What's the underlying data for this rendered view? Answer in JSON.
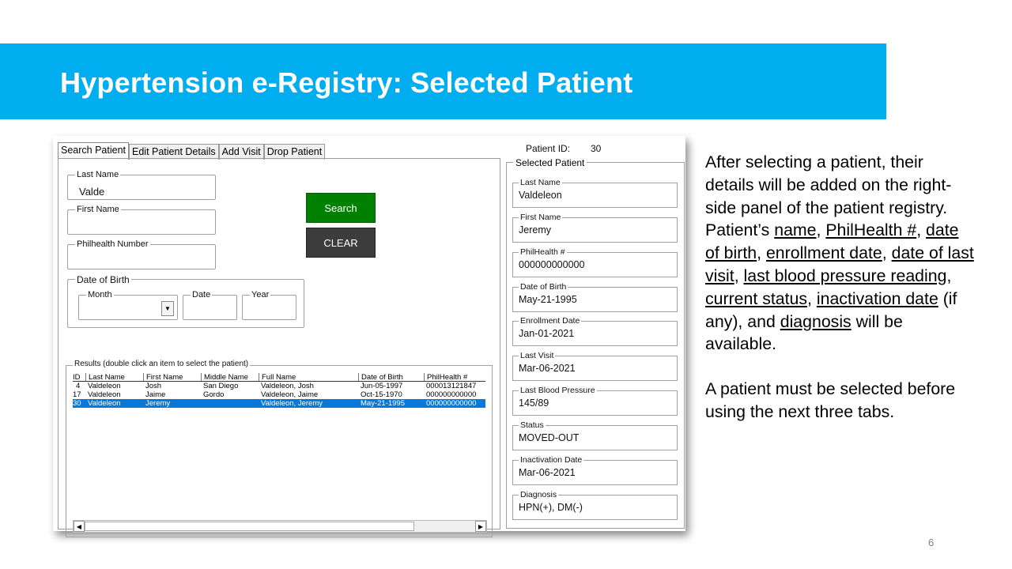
{
  "slide": {
    "title": "Hypertension e-Registry: Selected Patient",
    "number": "6",
    "colors": {
      "banner": "#00adef",
      "search_button": "#008000",
      "clear_button": "#3c3c3c",
      "selected_row": "#0a78d7"
    }
  },
  "app": {
    "tabs": [
      "Search Patient",
      "Edit Patient Details",
      "Add Visit",
      "Drop Patient"
    ],
    "active_tab": "Search Patient",
    "search": {
      "last_name_label": "Last Name",
      "last_name_value": "Valde",
      "first_name_label": "First Name",
      "first_name_value": "",
      "philhealth_label": "Philhealth Number",
      "philhealth_value": "",
      "dob_label": "Date of Birth",
      "month_label": "Month",
      "date_label": "Date",
      "year_label": "Year",
      "search_button": "Search",
      "clear_button": "CLEAR"
    },
    "results": {
      "title": "Results (double click an item to select the patient)",
      "columns": [
        "ID",
        "Last Name",
        "First Name",
        "Middle Name",
        "Full Name",
        "Date of Birth",
        "PhilHealth #"
      ],
      "rows": [
        {
          "id": "4",
          "last": "Valdeleon",
          "first": "Josh",
          "middle": "San Diego",
          "full": "Valdeleon, Josh",
          "dob": "Jun-05-1997",
          "phil": "000013121847"
        },
        {
          "id": "17",
          "last": "Valdeleon",
          "first": "Jaime",
          "middle": "Gordo",
          "full": "Valdeleon, Jaime",
          "dob": "Oct-15-1970",
          "phil": "000000000000"
        },
        {
          "id": "30",
          "last": "Valdeleon",
          "first": "Jeremy",
          "middle": "",
          "full": "Valdeleon, Jeremy",
          "dob": "May-21-1995",
          "phil": "000000000000"
        }
      ],
      "selected_row": 2
    },
    "patient_id_label": "Patient ID:",
    "patient_id": "30",
    "selected": {
      "title": "Selected Patient",
      "fields": [
        {
          "label": "Last Name",
          "value": "Valdeleon"
        },
        {
          "label": "First Name",
          "value": "Jeremy"
        },
        {
          "label": "PhilHealth #",
          "value": "000000000000"
        },
        {
          "label": "Date of Birth",
          "value": "May-21-1995"
        },
        {
          "label": "Enrollment Date",
          "value": "Jan-01-2021"
        },
        {
          "label": "Last Visit",
          "value": "Mar-06-2021"
        },
        {
          "label": "Last Blood Pressure",
          "value": "145/89"
        },
        {
          "label": "Status",
          "value": "MOVED-OUT"
        },
        {
          "label": "Inactivation Date",
          "value": "Mar-06-2021"
        },
        {
          "label": "Diagnosis",
          "value": "HPN(+), DM(-)"
        }
      ]
    }
  },
  "description": {
    "p1_parts": [
      {
        "t": "After selecting a patient, their details will be added on the right-side panel of the patient registry. Patient’s ",
        "u": false
      },
      {
        "t": "name",
        "u": true
      },
      {
        "t": ", ",
        "u": false
      },
      {
        "t": "PhilHealth #",
        "u": true
      },
      {
        "t": ", ",
        "u": false
      },
      {
        "t": "date of birth",
        "u": true
      },
      {
        "t": ", ",
        "u": false
      },
      {
        "t": "enrollment date",
        "u": true
      },
      {
        "t": ", ",
        "u": false
      },
      {
        "t": "date of last visit",
        "u": true
      },
      {
        "t": ", ",
        "u": false
      },
      {
        "t": "last blood pressure reading",
        "u": true
      },
      {
        "t": ", ",
        "u": false
      },
      {
        "t": "current status",
        "u": true
      },
      {
        "t": ", ",
        "u": false
      },
      {
        "t": "inactivation date",
        "u": true
      },
      {
        "t": " (if any), and ",
        "u": false
      },
      {
        "t": "diagnosis",
        "u": true
      },
      {
        "t": " will be available.",
        "u": false
      }
    ],
    "p2": "A patient must be selected before using the next three tabs."
  }
}
